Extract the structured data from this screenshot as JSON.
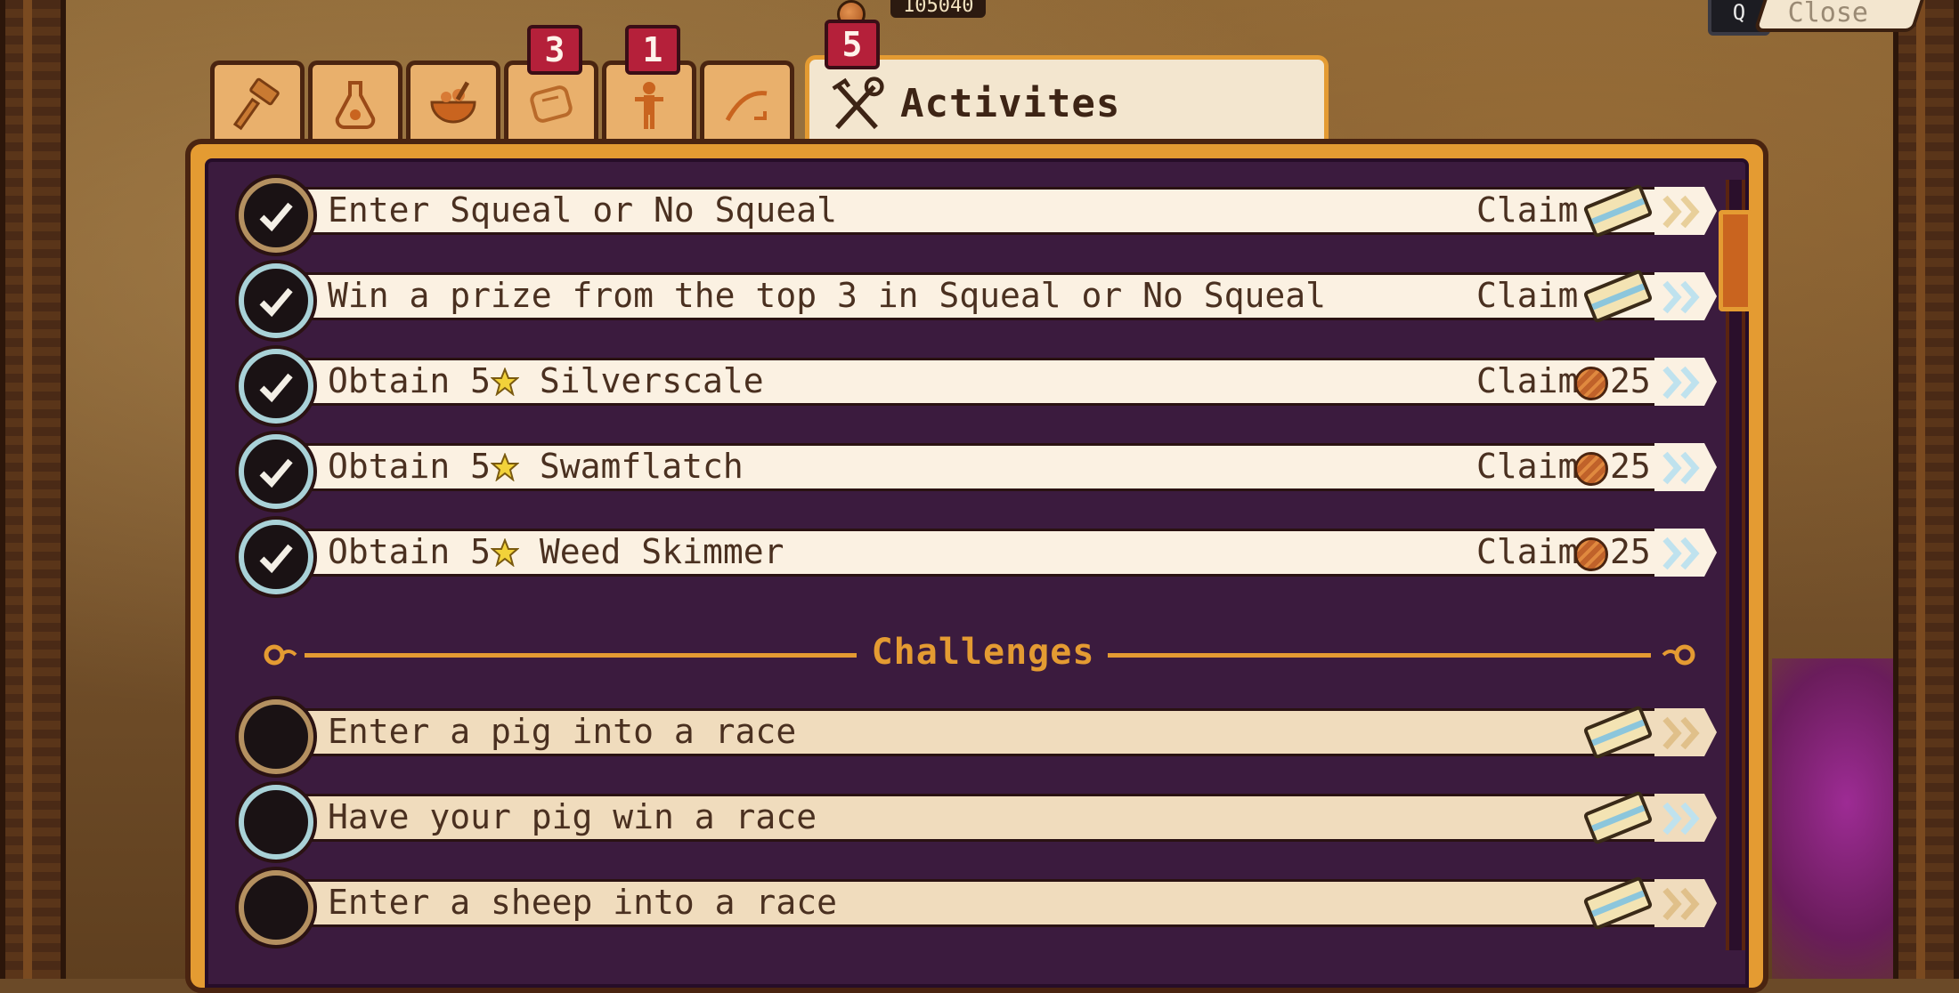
{
  "top": {
    "counter": "105040",
    "close_key": "Q",
    "close_label": "Close"
  },
  "tabs": [
    {
      "icon": "hammer-icon",
      "badge": ""
    },
    {
      "icon": "potion-icon",
      "badge": ""
    },
    {
      "icon": "cooking-bowl-icon",
      "badge": ""
    },
    {
      "icon": "scroll-icon",
      "badge": "3"
    },
    {
      "icon": "person-icon",
      "badge": "1"
    },
    {
      "icon": "sickle-icon",
      "badge": ""
    }
  ],
  "active_tab": {
    "label": "Activites",
    "badge": "5",
    "icon": "crossed-tools-icon"
  },
  "activities": [
    {
      "text": "Enter Squeal or No Squeal",
      "action": "Claim",
      "reward": "ticket-icon",
      "ring": "gold"
    },
    {
      "text": "Win a prize from the top 3 in Squeal or No Squeal",
      "action": "Claim",
      "reward": "ticket-icon",
      "ring": "teal"
    },
    {
      "text_prefix": "Obtain 5",
      "text_suffix": "Silverscale",
      "action": "Claim",
      "reward": "coin-icon",
      "amount": "25",
      "ring": "teal"
    },
    {
      "text_prefix": "Obtain 5",
      "text_suffix": "Swamflatch",
      "action": "Claim",
      "reward": "coin-icon",
      "amount": "25",
      "ring": "teal"
    },
    {
      "text_prefix": "Obtain 5",
      "text_suffix": "Weed Skimmer",
      "action": "Claim",
      "reward": "coin-icon",
      "amount": "25",
      "ring": "teal"
    }
  ],
  "challenges_title": "Challenges",
  "challenges": [
    {
      "text": "Enter a pig into a race",
      "reward": "ticket-icon",
      "ring": "gold"
    },
    {
      "text": "Have your pig win a race",
      "reward": "ticket-icon",
      "ring": "teal"
    },
    {
      "text": "Enter a sheep into a race",
      "reward": "ticket-icon",
      "ring": "gold"
    }
  ],
  "colors": {
    "accent": "#e49b32",
    "panel": "#3b1b3e",
    "badge": "#b5203a",
    "row": "#fbf1e2",
    "row_pending": "#f0dcbd"
  }
}
